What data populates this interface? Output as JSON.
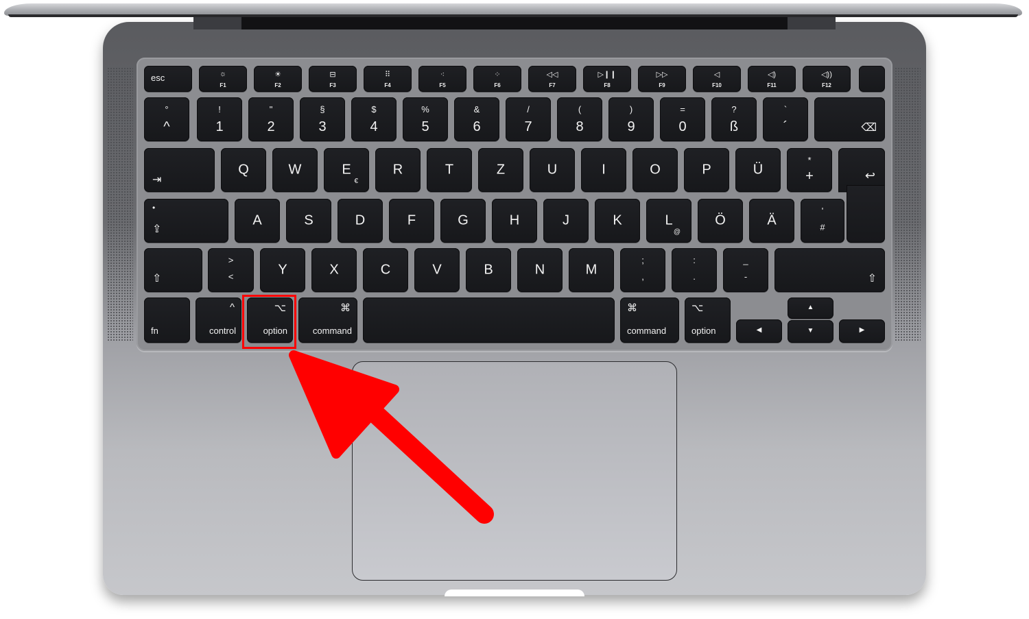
{
  "keyboard": {
    "layout": "German (ISO)",
    "function_row": [
      {
        "label": "esc"
      },
      {
        "icon": "brightness-down-icon",
        "glyph": "☼",
        "label": "F1"
      },
      {
        "icon": "brightness-up-icon",
        "glyph": "☀",
        "label": "F2"
      },
      {
        "icon": "mission-control-icon",
        "glyph": "⊟",
        "label": "F3"
      },
      {
        "icon": "launchpad-icon",
        "glyph": "⠿",
        "label": "F4"
      },
      {
        "icon": "keyboard-backlight-down-icon",
        "glyph": "⁖",
        "label": "F5"
      },
      {
        "icon": "keyboard-backlight-up-icon",
        "glyph": "⁘",
        "label": "F6"
      },
      {
        "icon": "rewind-icon",
        "glyph": "◁◁",
        "label": "F7"
      },
      {
        "icon": "play-pause-icon",
        "glyph": "▷❙❙",
        "label": "F8"
      },
      {
        "icon": "fast-forward-icon",
        "glyph": "▷▷",
        "label": "F9"
      },
      {
        "icon": "mute-icon",
        "glyph": "◁",
        "label": "F10"
      },
      {
        "icon": "volume-down-icon",
        "glyph": "◁)",
        "label": "F11"
      },
      {
        "icon": "volume-up-icon",
        "glyph": "◁))",
        "label": "F12"
      },
      {
        "icon": "touch-id-icon",
        "label": ""
      }
    ],
    "number_row": [
      {
        "top": "°",
        "bottom": "^"
      },
      {
        "top": "!",
        "bottom": "1"
      },
      {
        "top": "\"",
        "bottom": "2"
      },
      {
        "top": "§",
        "bottom": "3"
      },
      {
        "top": "$",
        "bottom": "4"
      },
      {
        "top": "%",
        "bottom": "5"
      },
      {
        "top": "&",
        "bottom": "6"
      },
      {
        "top": "/",
        "bottom": "7"
      },
      {
        "top": "(",
        "bottom": "8"
      },
      {
        "top": ")",
        "bottom": "9"
      },
      {
        "top": "=",
        "bottom": "0"
      },
      {
        "top": "?",
        "bottom": "ß"
      },
      {
        "top": "`",
        "bottom": "´"
      },
      {
        "icon": "delete-icon",
        "glyph": "⌫"
      }
    ],
    "qwertz_row": {
      "tab_glyph": "⇥",
      "keys": [
        "Q",
        "W",
        "E",
        "R",
        "T",
        "Z",
        "U",
        "I",
        "O",
        "P",
        "Ü"
      ],
      "e_alt": "€",
      "plus_top": "*",
      "plus_bottom": "+",
      "return_glyph": "↩"
    },
    "home_row": {
      "caps_dot": "•",
      "caps_glyph": "⇪",
      "keys": [
        "A",
        "S",
        "D",
        "F",
        "G",
        "H",
        "J",
        "K",
        "L",
        "Ö",
        "Ä"
      ],
      "l_alt": "@",
      "hash_top": "'",
      "hash_bottom": "#"
    },
    "bottom_letter_row": {
      "shift_glyph": "⇧",
      "angle_top": ">",
      "angle_bottom": "<",
      "keys": [
        "Y",
        "X",
        "C",
        "V",
        "B",
        "N",
        "M"
      ],
      "punct": [
        {
          "top": ";",
          "bottom": ","
        },
        {
          "top": ":",
          "bottom": "."
        },
        {
          "top": "_",
          "bottom": "-"
        }
      ]
    },
    "modifier_row": {
      "fn": "fn",
      "control": {
        "glyph": "^",
        "label": "control"
      },
      "option_left": {
        "glyph": "⌥",
        "label": "option"
      },
      "command_left": {
        "glyph": "⌘",
        "label": "command"
      },
      "command_right": {
        "glyph": "⌘",
        "label": "command"
      },
      "option_right": {
        "glyph": "⌥",
        "label": "option"
      },
      "arrows": {
        "up": "▲",
        "down": "▼",
        "left": "◀",
        "right": "▶"
      }
    }
  },
  "annotation": {
    "highlighted_key": "option",
    "color": "#ff0000"
  }
}
